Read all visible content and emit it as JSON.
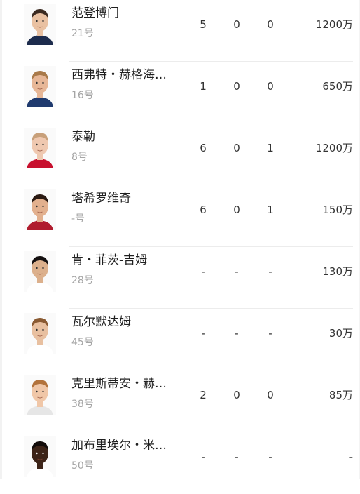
{
  "players": [
    {
      "name": "范登博门",
      "number": "21号",
      "apps": "5",
      "goals": "0",
      "assists": "0",
      "value": "1200万",
      "skin": "#e9c1a2",
      "hair": "#3b2a20",
      "shirt": "#1d2c4d"
    },
    {
      "name": "西弗特・赫格海…",
      "number": "16号",
      "apps": "1",
      "goals": "0",
      "assists": "0",
      "value": "650万",
      "skin": "#e7b797",
      "hair": "#a97a4a",
      "shirt": "#1f3a6e"
    },
    {
      "name": "泰勒",
      "number": "8号",
      "apps": "6",
      "goals": "0",
      "assists": "1",
      "value": "1200万",
      "skin": "#efc8b0",
      "hair": "#c8a07a",
      "shirt": "#c8102e"
    },
    {
      "name": "塔希罗维奇",
      "number": "-号",
      "apps": "6",
      "goals": "0",
      "assists": "1",
      "value": "150万",
      "skin": "#e2b08e",
      "hair": "#2a1a12",
      "shirt": "#b01c2e"
    },
    {
      "name": "肯・菲茨-吉姆",
      "number": "28号",
      "apps": "-",
      "goals": "-",
      "assists": "-",
      "value": "130万",
      "skin": "#dcb08c",
      "hair": "#141010",
      "shirt": "#ffffff"
    },
    {
      "name": "瓦尔默达姆",
      "number": "45号",
      "apps": "-",
      "goals": "-",
      "assists": "-",
      "value": "30万",
      "skin": "#e8c0a0",
      "hair": "#8a5a32",
      "shirt": "#ffffff"
    },
    {
      "name": "克里斯蒂安・赫…",
      "number": "38号",
      "apps": "2",
      "goals": "0",
      "assists": "0",
      "value": "85万",
      "skin": "#f0c7a8",
      "hair": "#b3733c",
      "shirt": "#e6e6e6"
    },
    {
      "name": "加布里埃尔・米…",
      "number": "50号",
      "apps": "-",
      "goals": "-",
      "assists": "-",
      "value": "-",
      "skin": "#3d2418",
      "hair": "#120c0a",
      "shirt": "#ffffff"
    }
  ]
}
